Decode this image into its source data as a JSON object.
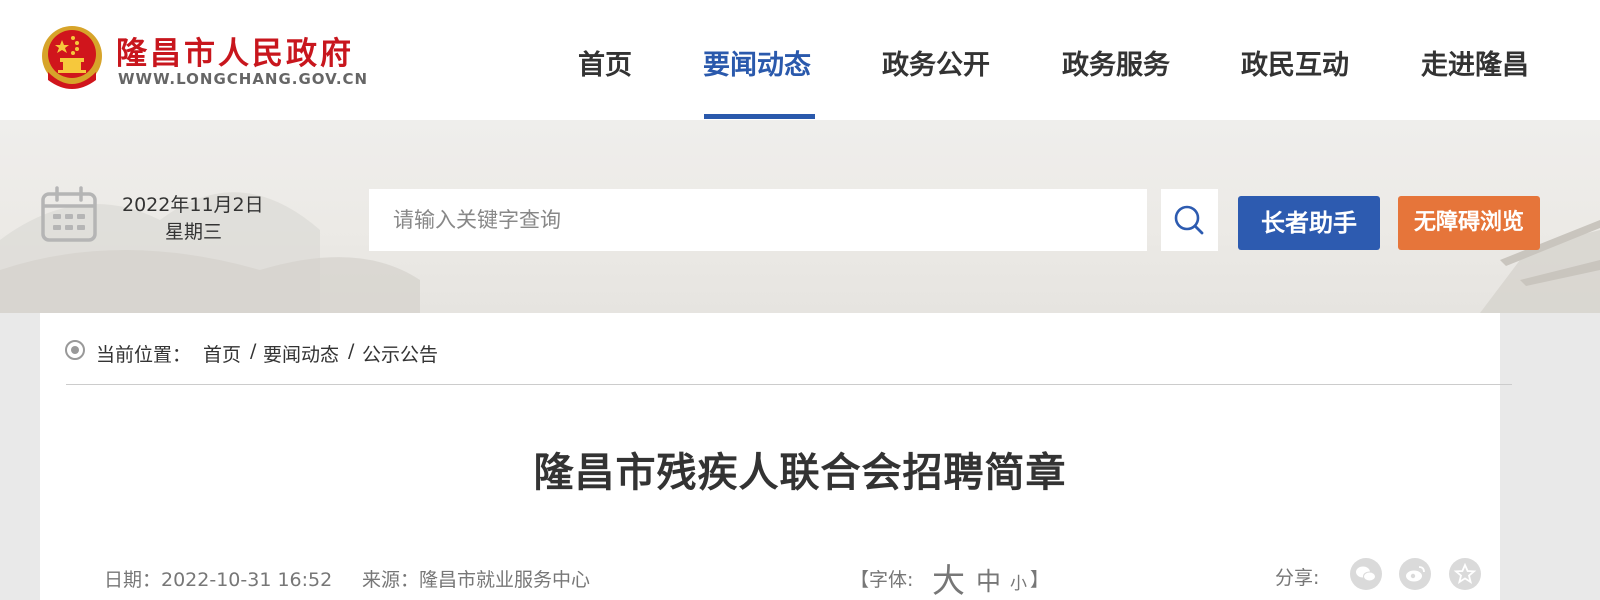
{
  "site": {
    "name": "隆昌市人民政府",
    "url": "WWW.LONGCHANG.GOV.CN",
    "brand_color": "#c8161d"
  },
  "nav": {
    "items": [
      {
        "label": "首页",
        "active": false
      },
      {
        "label": "要闻动态",
        "active": true
      },
      {
        "label": "政务公开",
        "active": false
      },
      {
        "label": "政务服务",
        "active": false
      },
      {
        "label": "政民互动",
        "active": false
      },
      {
        "label": "走进隆昌",
        "active": false
      }
    ],
    "active_color": "#2a59ac"
  },
  "toolbar": {
    "date": "2022年11月2日",
    "weekday": "星期三",
    "search_placeholder": "请输入关键字查询",
    "elder_label": "长者助手",
    "barrier_label": "无障碍浏览",
    "elder_color": "#2d5bb0",
    "barrier_color": "#e6753a"
  },
  "breadcrumb": {
    "label": "当前位置：",
    "items": [
      "首页",
      "要闻动态",
      "公示公告"
    ],
    "separator": "/"
  },
  "article": {
    "title": "隆昌市残疾人联合会招聘简章",
    "date": "日期：2022-10-31 16:52",
    "source": "来源：隆昌市就业服务中心",
    "font_label_open": "【字体:",
    "font_large": "大",
    "font_medium": "中",
    "font_small": "小",
    "font_label_close": "】",
    "share_label": "分享:"
  },
  "icons": {
    "search": "search-icon",
    "calendar": "calendar-icon",
    "wechat": "wechat-icon",
    "weibo": "weibo-icon",
    "favorite": "star-icon"
  }
}
